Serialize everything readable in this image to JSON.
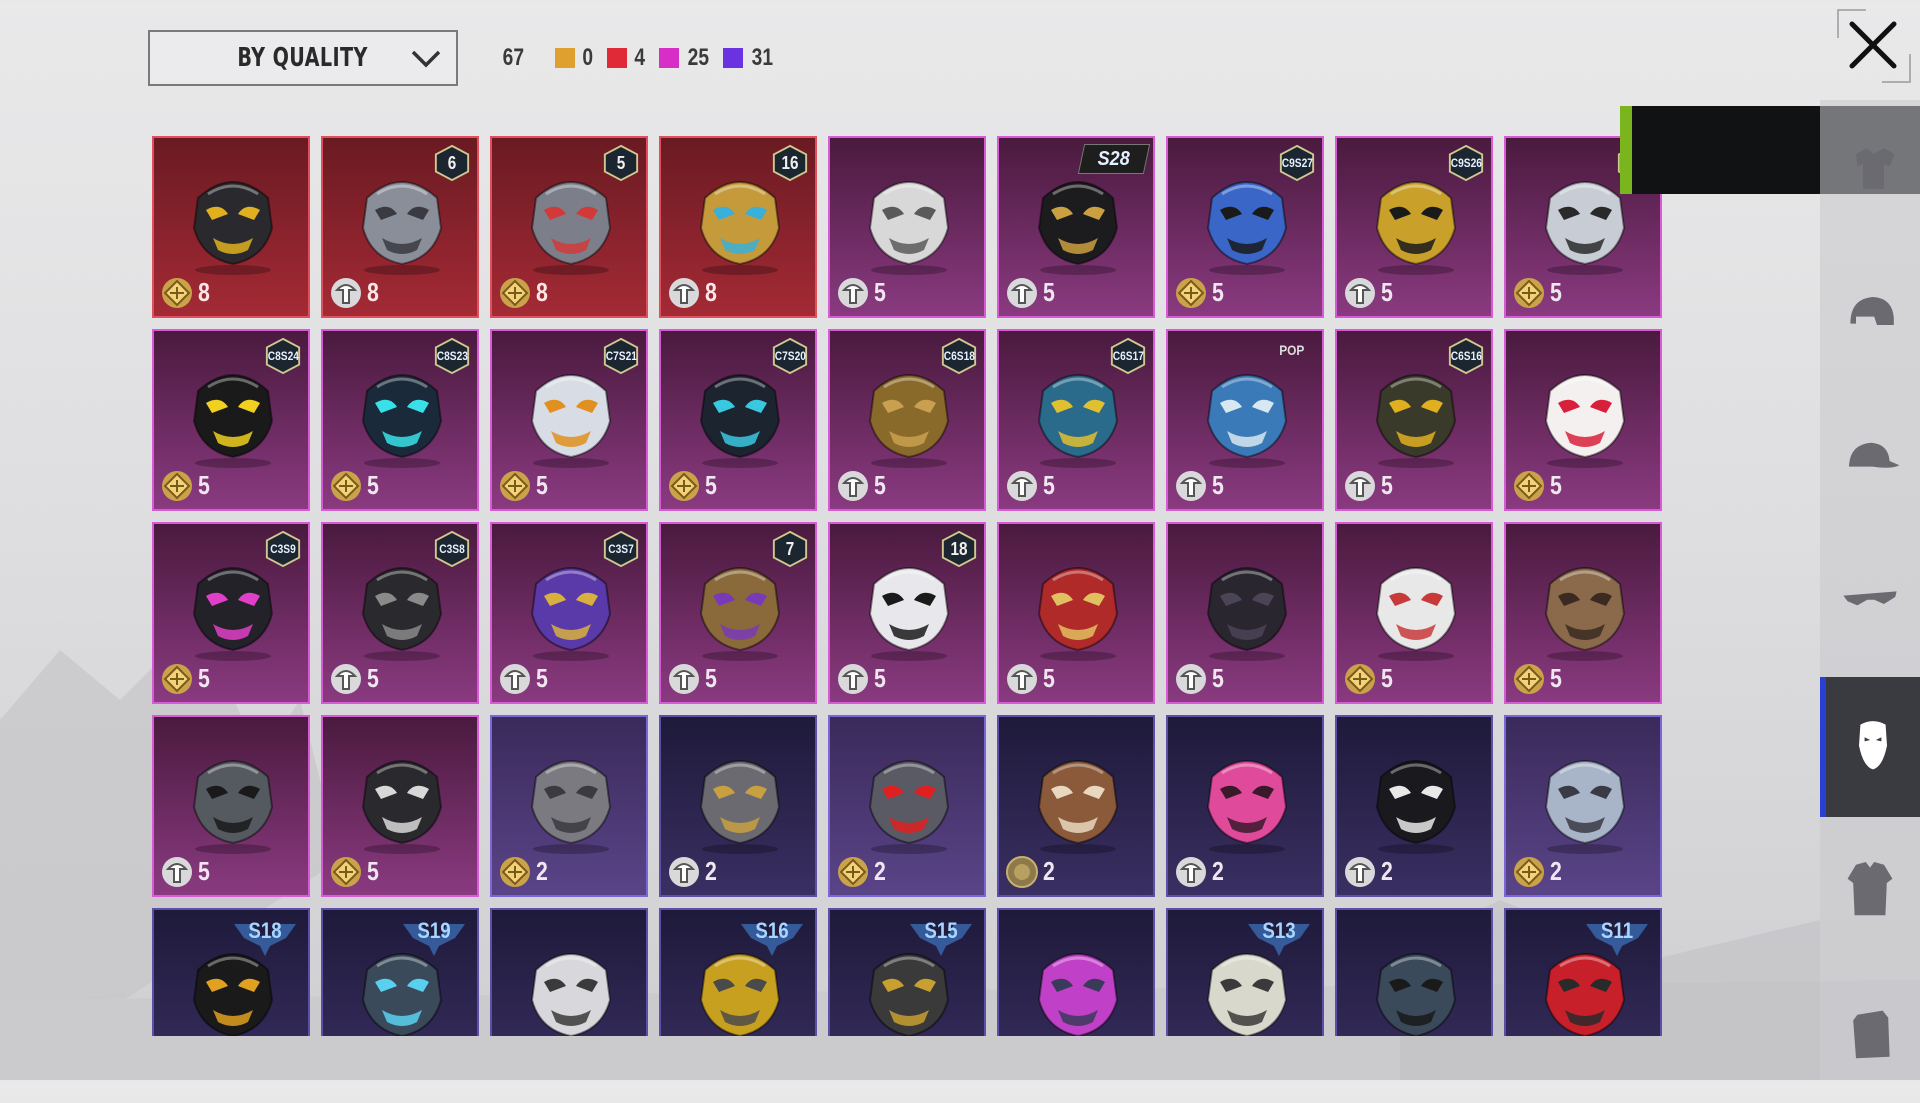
{
  "toolbar": {
    "sort_label": "BY QUALITY",
    "sort_icon": "chevron-down-icon",
    "total": "67",
    "quality_counts": [
      {
        "color": "#e0a030",
        "count": "0"
      },
      {
        "color": "#e02a38",
        "count": "4"
      },
      {
        "color": "#d82ec8",
        "count": "25"
      },
      {
        "color": "#6a32e0",
        "count": "31"
      }
    ],
    "close_icon": "close-icon"
  },
  "items": [
    {
      "rarity": "red",
      "qty": "8",
      "currency": "gold",
      "badge": "",
      "icon": "skull-gasmask-icon"
    },
    {
      "rarity": "red",
      "qty": "8",
      "currency": "silver",
      "badge": "6",
      "icon": "plague-mask-icon"
    },
    {
      "rarity": "red",
      "qty": "8",
      "currency": "gold",
      "badge": "5",
      "icon": "mech-visor-icon"
    },
    {
      "rarity": "red",
      "qty": "8",
      "currency": "silver",
      "badge": "16",
      "icon": "golden-helm-icon"
    },
    {
      "rarity": "pink",
      "qty": "5",
      "currency": "silver",
      "badge": "",
      "icon": "cat-mask-icon"
    },
    {
      "rarity": "pink",
      "qty": "5",
      "currency": "silver",
      "badge": "S28",
      "badge_type": "txt",
      "icon": "black-facemask-icon"
    },
    {
      "rarity": "pink",
      "qty": "5",
      "currency": "gold",
      "badge": "C9S27",
      "icon": "blue-respirator-icon"
    },
    {
      "rarity": "pink",
      "qty": "5",
      "currency": "silver",
      "badge": "C9S26",
      "icon": "gold-mask-icon"
    },
    {
      "rarity": "pink",
      "qty": "5",
      "currency": "gold",
      "badge": "C9S25",
      "icon": "silver-mask-icon"
    },
    {
      "rarity": "pink",
      "qty": "5",
      "currency": "gold",
      "badge": "C8S24",
      "icon": "yellow-visor-icon"
    },
    {
      "rarity": "pink",
      "qty": "5",
      "currency": "gold",
      "badge": "C8S23",
      "icon": "neon-mask-icon"
    },
    {
      "rarity": "pink",
      "qty": "5",
      "currency": "gold",
      "badge": "C7S21",
      "icon": "white-cyber-mask-icon"
    },
    {
      "rarity": "pink",
      "qty": "5",
      "currency": "gold",
      "badge": "C7S20",
      "icon": "teal-mask-icon"
    },
    {
      "rarity": "pink",
      "qty": "5",
      "currency": "silver",
      "badge": "C6S18",
      "icon": "bronze-jaw-icon"
    },
    {
      "rarity": "pink",
      "qty": "5",
      "currency": "silver",
      "badge": "C6S17",
      "icon": "yellow-pattern-mask-icon"
    },
    {
      "rarity": "pink",
      "qty": "5",
      "currency": "silver",
      "badge": "POP",
      "badge_type": "pop",
      "icon": "blue-demon-mask-icon"
    },
    {
      "rarity": "pink",
      "qty": "5",
      "currency": "silver",
      "badge": "C6S16",
      "icon": "yellow-gasmask-icon"
    },
    {
      "rarity": "pink",
      "qty": "5",
      "currency": "gold",
      "badge": "",
      "icon": "fox-mask-icon"
    },
    {
      "rarity": "pink",
      "qty": "5",
      "currency": "gold",
      "badge": "C3S9",
      "icon": "pink-gasmask-icon"
    },
    {
      "rarity": "pink",
      "qty": "5",
      "currency": "silver",
      "badge": "C3S8",
      "icon": "black-respirator-icon"
    },
    {
      "rarity": "pink",
      "qty": "5",
      "currency": "silver",
      "badge": "C3S7",
      "icon": "gold-veil-mask-icon"
    },
    {
      "rarity": "pink",
      "qty": "5",
      "currency": "silver",
      "badge": "7",
      "icon": "tribal-mask-icon"
    },
    {
      "rarity": "pink",
      "qty": "5",
      "currency": "silver",
      "badge": "18",
      "badge_type": "event",
      "icon": "x-facemask-icon"
    },
    {
      "rarity": "pink",
      "qty": "5",
      "currency": "silver",
      "badge": "",
      "icon": "red-beak-mask-icon"
    },
    {
      "rarity": "pink",
      "qty": "5",
      "currency": "silver",
      "badge": "",
      "icon": "dark-mask-icon"
    },
    {
      "rarity": "pink",
      "qty": "5",
      "currency": "gold",
      "badge": "",
      "icon": "skull-bandana-icon"
    },
    {
      "rarity": "pink",
      "qty": "5",
      "currency": "gold",
      "badge": "",
      "icon": "plague-doctor-icon"
    },
    {
      "rarity": "pink",
      "qty": "5",
      "currency": "silver",
      "badge": "",
      "icon": "balaclava-icon"
    },
    {
      "rarity": "pink",
      "qty": "5",
      "currency": "gold",
      "badge": "",
      "icon": "skull-scarf-icon"
    },
    {
      "rarity": "purple",
      "qty": "2",
      "currency": "gold",
      "badge": "",
      "icon": "grey-facemask-icon"
    },
    {
      "rarity": "dark",
      "qty": "2",
      "currency": "silver",
      "badge": "",
      "icon": "knight-visor-icon"
    },
    {
      "rarity": "purple",
      "qty": "2",
      "currency": "gold",
      "badge": "",
      "icon": "red-eye-visor-icon"
    },
    {
      "rarity": "dark",
      "qty": "2",
      "currency": "coin",
      "badge": "",
      "icon": "mammoth-mask-icon"
    },
    {
      "rarity": "dark",
      "qty": "2",
      "currency": "silver",
      "badge": "",
      "icon": "pink-dino-mask-icon"
    },
    {
      "rarity": "dark",
      "qty": "2",
      "currency": "silver",
      "badge": "",
      "icon": "grin-facemask-icon"
    },
    {
      "rarity": "purple",
      "qty": "2",
      "currency": "gold",
      "badge": "",
      "icon": "steel-mask-icon"
    },
    {
      "rarity": "dark",
      "qty": "",
      "currency": "",
      "badge": "S18",
      "badge_type": "season",
      "icon": "heartbeat-mask-icon"
    },
    {
      "rarity": "dark",
      "qty": "",
      "currency": "",
      "badge": "S19",
      "badge_type": "season",
      "icon": "cyber-visor-icon"
    },
    {
      "rarity": "dark",
      "qty": "",
      "currency": "",
      "badge": "",
      "icon": "white-half-mask-icon"
    },
    {
      "rarity": "dark",
      "qty": "",
      "currency": "",
      "badge": "S16",
      "badge_type": "season",
      "icon": "tech-goggles-icon"
    },
    {
      "rarity": "dark",
      "qty": "",
      "currency": "",
      "badge": "S15",
      "badge_type": "season",
      "icon": "horned-helm-icon"
    },
    {
      "rarity": "dark",
      "qty": "",
      "currency": "",
      "badge": "",
      "icon": "pink-goggle-mask-icon"
    },
    {
      "rarity": "dark",
      "qty": "",
      "currency": "",
      "badge": "S13",
      "badge_type": "season",
      "icon": "round-goggles-icon"
    },
    {
      "rarity": "dark",
      "qty": "",
      "currency": "",
      "badge": "",
      "icon": "headset-mask-icon"
    },
    {
      "rarity": "dark",
      "qty": "",
      "currency": "",
      "badge": "S11",
      "badge_type": "season",
      "icon": "red-mouth-guard-icon"
    }
  ],
  "sidebar": [
    {
      "icon": "shirt-icon",
      "active": false
    },
    {
      "icon": "helmet-icon",
      "active": false
    },
    {
      "icon": "cap-icon",
      "active": false
    },
    {
      "icon": "glasses-icon",
      "active": false
    },
    {
      "icon": "mask-icon",
      "active": true
    },
    {
      "icon": "jacket-icon",
      "active": false
    },
    {
      "icon": "backpack-icon",
      "active": false
    }
  ]
}
